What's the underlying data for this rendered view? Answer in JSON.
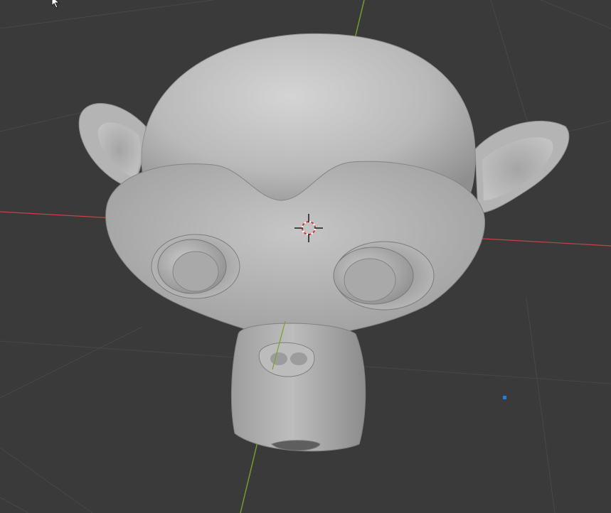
{
  "viewport": {
    "background_color": "#3a3a3a",
    "grid_color": "#4a4a4a",
    "x_axis_color": "#c5424b",
    "y_axis_color": "#7aa12a",
    "mesh_color": "#b6b6b6",
    "mesh_shadow_color": "#6d6d6d",
    "mesh_highlight_color": "#d2d2d2"
  },
  "scene_object": {
    "name_hint": "monkey-mesh",
    "selected": false
  },
  "cursor_3d": {
    "icon": "3d-cursor-icon",
    "ring_colors": [
      "#ffffff",
      "#d23a3a"
    ]
  },
  "selected_vertex": {
    "icon": "vertex-dot-icon",
    "color": "#1f7fe0"
  },
  "mouse_pointer": {
    "icon": "mouse-pointer-icon"
  }
}
